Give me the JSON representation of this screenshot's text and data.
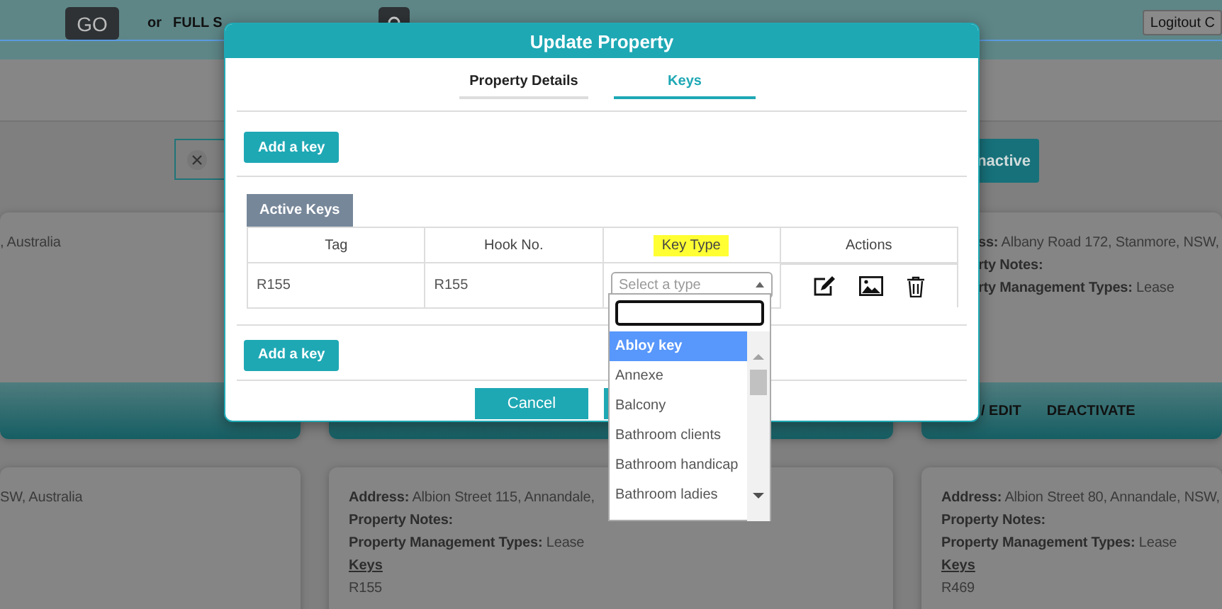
{
  "top_bar": {
    "go_button": "GO",
    "or_label": "or",
    "search_label": "FULL S",
    "logout_button": "Logitout C"
  },
  "filter_bar": {
    "status_button": "nactive"
  },
  "cards": [
    {
      "fields": [
        {
          "value": ", Australia"
        }
      ]
    },
    {
      "fields": [
        {
          "label": "ss:",
          "value": "Albany Road 172, Stanmore, NSW,"
        },
        {
          "label": "rty Notes:"
        },
        {
          "label": "rty Management Types:",
          "value": "Lease"
        }
      ],
      "footer_actions": [
        "/ EDIT",
        "DEACTIVATE"
      ]
    },
    {
      "fields": [
        {
          "value": "SW, Australia"
        }
      ]
    },
    {
      "fields": [
        {
          "label": "Address:",
          "value": "Albion Street 115, Annandale,"
        },
        {
          "label": "Property Notes:"
        },
        {
          "label": "Property Management Types:",
          "value": "Lease"
        }
      ],
      "keys_heading": "Keys",
      "keys": [
        "R155"
      ]
    },
    {
      "fields": [
        {
          "label": "Address:",
          "value": "Albion Street 80, Annandale, NSW,"
        },
        {
          "label": "Property Notes:"
        },
        {
          "label": "Property Management Types:",
          "value": "Lease"
        }
      ],
      "keys_heading": "Keys",
      "keys": [
        "R469"
      ]
    }
  ],
  "modal": {
    "title": "Update Property",
    "tabs": [
      {
        "label": "Property Details",
        "selected": false
      },
      {
        "label": "Keys",
        "selected": true
      }
    ],
    "add_key_buttons": [
      "Add a key",
      "Add a key"
    ],
    "section_tab": "Active Keys",
    "table": {
      "columns": [
        {
          "label": "Tag",
          "highlighted": false
        },
        {
          "label": "Hook No.",
          "highlighted": false
        },
        {
          "label": "Key Type",
          "highlighted": true
        },
        {
          "label": "Actions",
          "highlighted": false
        }
      ],
      "rows": [
        {
          "tag": "R155",
          "hook_no": "R155",
          "key_type": {
            "placeholder": "Select a type"
          }
        }
      ]
    },
    "footer_buttons": [
      "Cancel"
    ],
    "dropdown": {
      "options": [
        {
          "label": "Abloy key",
          "selected": true
        },
        {
          "label": "Annexe",
          "selected": false
        },
        {
          "label": "Balcony",
          "selected": false
        },
        {
          "label": "Bathroom clients",
          "selected": false
        },
        {
          "label": "Bathroom handicap",
          "selected": false
        },
        {
          "label": "Bathroom ladies",
          "selected": false
        }
      ]
    }
  }
}
